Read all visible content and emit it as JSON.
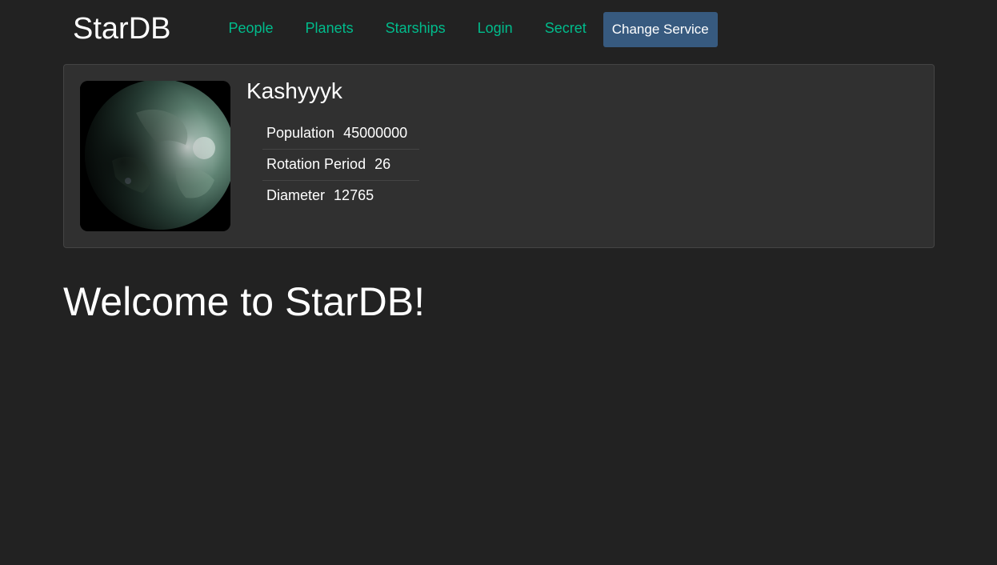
{
  "header": {
    "brand": "StarDB",
    "nav": [
      {
        "label": "People"
      },
      {
        "label": "Planets"
      },
      {
        "label": "Starships"
      },
      {
        "label": "Login"
      },
      {
        "label": "Secret"
      }
    ],
    "change_service_label": "Change Service"
  },
  "random_planet": {
    "name": "Kashyyyk",
    "properties": [
      {
        "label": "Population",
        "value": "45000000"
      },
      {
        "label": "Rotation Period",
        "value": "26"
      },
      {
        "label": "Diameter",
        "value": "12765"
      }
    ]
  },
  "main": {
    "heading": "Welcome to StarDB!"
  },
  "colors": {
    "background": "#222222",
    "card": "#303030",
    "nav_link": "#00bc8c",
    "button": "#375a7f"
  }
}
